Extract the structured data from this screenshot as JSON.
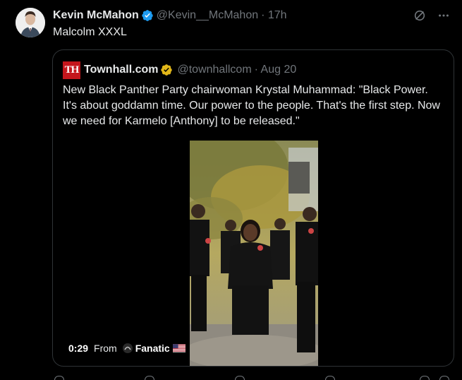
{
  "tweet": {
    "author_name": "Kevin McMahon",
    "author_handle": "@Kevin__McMahon",
    "time": "· 17h",
    "text": "Malcolm XXXL",
    "avatar_icon": "avatar-photo",
    "verified_icon": "verified-badge-icon"
  },
  "quote": {
    "logo_text": "TH",
    "author_name": "Townhall.com",
    "author_handle": "@townhallcom",
    "time": "· Aug 20",
    "text": "New Black Panther Party chairwoman Krystal Muhammad: \"Black Power. It's about goddamn time. Our power to the people. That's the first step. Now we need for Karmelo [Anthony] to be released.\"",
    "verified_icon": "gold-verified-badge-icon",
    "video": {
      "duration": "0:29",
      "from_label": "From",
      "channel": "Fanatic",
      "flag_icon": "us-flag-icon"
    }
  },
  "colors": {
    "background": "#000000",
    "text": "#e7e9ea",
    "muted": "#71767b",
    "border": "#2f3336",
    "verified_blue": "#1d9bf0",
    "verified_gold": "#e2b719",
    "townhall_red": "#c4161c"
  }
}
